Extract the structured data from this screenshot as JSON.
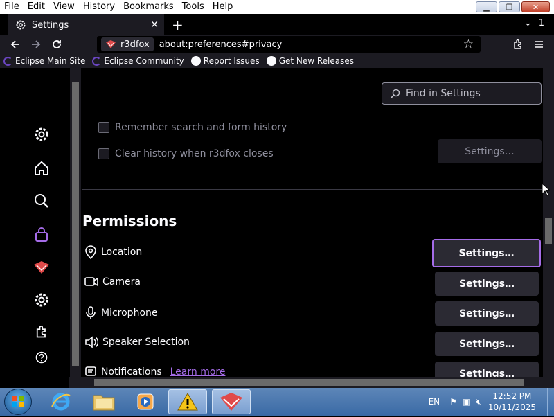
{
  "menubar": {
    "items": [
      "File",
      "Edit",
      "View",
      "History",
      "Bookmarks",
      "Tools",
      "Help"
    ]
  },
  "tab": {
    "title": "Settings",
    "tab_count": "1"
  },
  "navbar": {
    "identity_label": "r3dfox",
    "url": "about:preferences#privacy"
  },
  "bookmarks": [
    {
      "label": "Eclipse Main Site",
      "icon": "eclipse-icon"
    },
    {
      "label": "Eclipse Community",
      "icon": "eclipse-icon"
    },
    {
      "label": "Report Issues",
      "icon": "github-icon"
    },
    {
      "label": "Get New Releases",
      "icon": "github-icon"
    }
  ],
  "settings": {
    "search_placeholder": "Find in Settings",
    "history": {
      "remember_label": "Remember search and form history",
      "clear_label": "Clear history when r3dfox closes",
      "settings_button": "Settings…"
    },
    "permissions": {
      "heading": "Permissions",
      "items": [
        {
          "label": "Location",
          "icon": "location-pin-icon",
          "button": "Settings…"
        },
        {
          "label": "Camera",
          "icon": "camera-icon",
          "button": "Settings…"
        },
        {
          "label": "Microphone",
          "icon": "microphone-icon",
          "button": "Settings…"
        },
        {
          "label": "Speaker Selection",
          "icon": "speaker-icon",
          "button": "Settings…"
        },
        {
          "label": "Notifications",
          "icon": "notification-icon",
          "button": "Settings…",
          "link": "Learn more"
        }
      ]
    }
  },
  "taskbar": {
    "language": "EN",
    "time": "12:52 PM",
    "date": "10/11/2025"
  },
  "colors": {
    "accent": "#a56ce8",
    "background": "#000000",
    "panel": "#1c1b22",
    "button": "#2b2a33"
  }
}
